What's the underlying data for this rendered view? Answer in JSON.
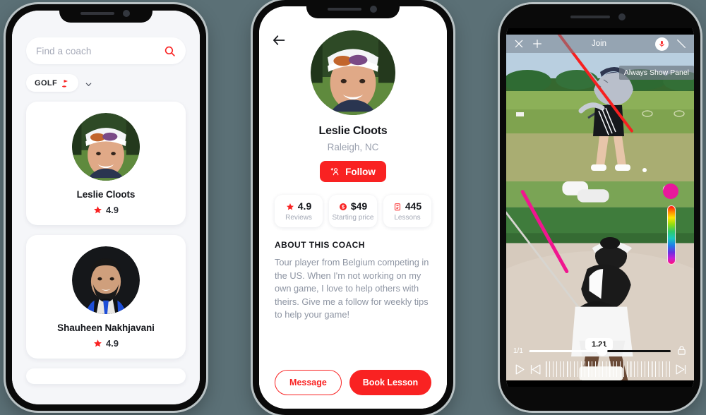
{
  "background_color": "#5b7076",
  "accent_color": "#f92222",
  "phone1": {
    "name": "coach-search-screen",
    "search": {
      "placeholder": "Find a coach",
      "value": "",
      "icon": "search-icon"
    },
    "filter_chip": {
      "label": "GOLF",
      "icon": "golf-flag-icon",
      "dropdown_icon": "chevron-down-icon"
    },
    "coaches": [
      {
        "name": "Leslie Cloots",
        "rating": "4.9",
        "rating_icon": "star-icon",
        "avatar": "leslie-cloots-avatar"
      },
      {
        "name": "Shauheen Nakhjavani",
        "rating": "4.9",
        "rating_icon": "star-icon",
        "avatar": "shauheen-nakhjavani-avatar"
      }
    ]
  },
  "phone2": {
    "name": "coach-profile-screen",
    "back_icon": "back-arrow-icon",
    "profile": {
      "avatar": "leslie-cloots-avatar",
      "name": "Leslie Cloots",
      "location": "Raleigh, NC",
      "follow_label": "Follow",
      "follow_icon": "person-add-icon"
    },
    "stats": [
      {
        "value": "4.9",
        "label": "Reviews",
        "icon": "star-icon"
      },
      {
        "value": "$49",
        "label": "Starting price",
        "icon": "dollar-coin-icon"
      },
      {
        "value": "445",
        "label": "Lessons",
        "icon": "clipboard-icon"
      }
    ],
    "about": {
      "heading": "ABOUT THIS COACH",
      "body": "Tour player from Belgium competing in the US. When I'm not working on my own game, I love to help others with theirs. Give me a follow for weekly tips to help your game!"
    },
    "actions": {
      "message_label": "Message",
      "book_label": "Book Lesson"
    }
  },
  "phone3": {
    "name": "video-analysis-screen",
    "toolbar": {
      "close_icon": "close-x-icon",
      "add_icon": "plus-icon",
      "title": "Join",
      "mic_icon": "microphone-icon",
      "line_tool_icon": "line-tool-icon"
    },
    "panel_tag": "Always Show Panel",
    "top_video": {
      "name": "golfer-driving-range-video",
      "annotation_color": "#f72020"
    },
    "bottom_video": {
      "name": "golfer-bunker-video",
      "annotation_color": "#f0168f"
    },
    "color_picker": {
      "selected_color": "#e8189c",
      "spectrum": "rainbow-gradient-slider"
    },
    "playback": {
      "time_label": "1.21",
      "frame_index": "1/1",
      "lock_icon": "lock-icon",
      "play_icon": "play-icon",
      "prev_frame_icon": "previous-frame-icon",
      "next_frame_icon": "next-frame-icon",
      "filmstrip": "frame-scrubber"
    }
  }
}
